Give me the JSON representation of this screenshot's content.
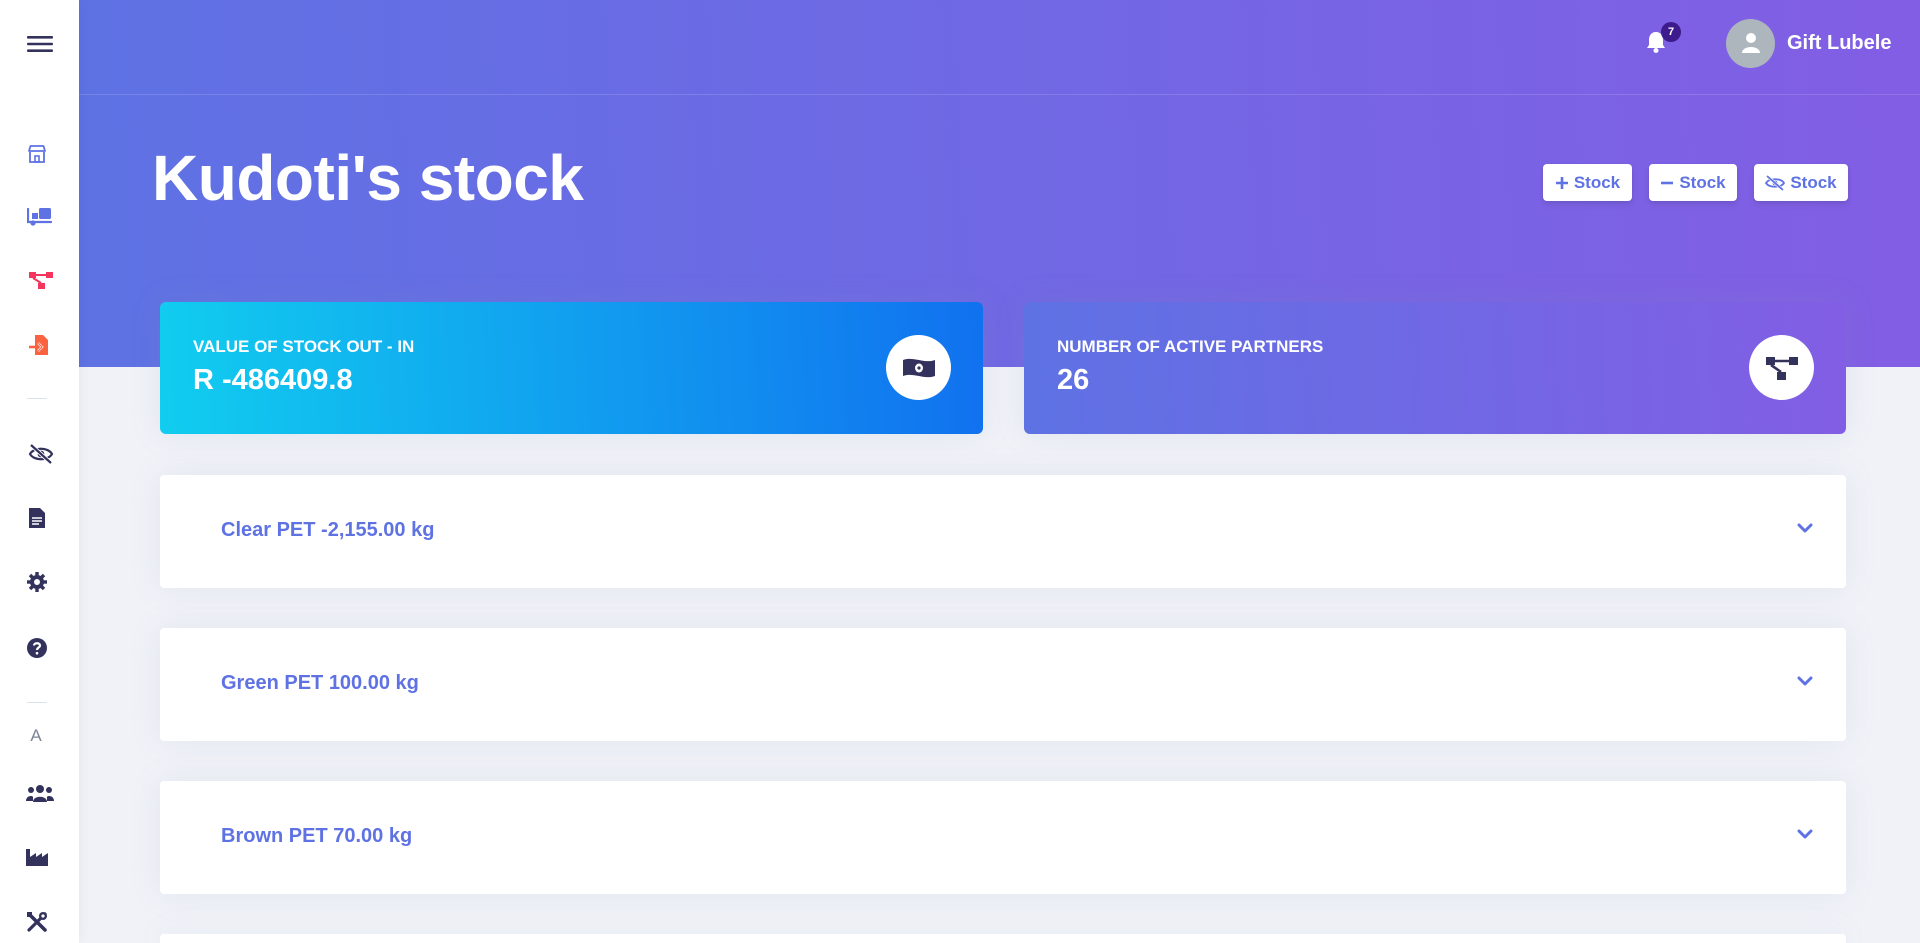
{
  "topbar": {
    "notification_count": "7",
    "user_name": "Gift Lubele"
  },
  "page": {
    "title": "Kudoti's stock"
  },
  "actions": [
    {
      "icon": "plus-icon",
      "label": "Stock"
    },
    {
      "icon": "minus-icon",
      "label": "Stock"
    },
    {
      "icon": "eye-slash-icon",
      "label": "Stock"
    }
  ],
  "stats": [
    {
      "label": "Value of stock out - in",
      "value": "R -486409.8",
      "icon": "money-bill-icon",
      "color_from": "#11cdef",
      "color_to": "#1171ef"
    },
    {
      "label": "Number of active partners",
      "value": "26",
      "icon": "network-icon",
      "color_from": "#5e72e4",
      "color_to": "#825ee4"
    }
  ],
  "stock_items": [
    {
      "label": "Clear PET -2,155.00 kg"
    },
    {
      "label": "Green PET 100.00 kg"
    },
    {
      "label": "Brown PET 70.00 kg"
    }
  ],
  "sidebar": {
    "letter": "A",
    "icons": [
      "menu-icon",
      "store-icon",
      "truck-loading-icon",
      "network-icon",
      "file-import-icon",
      "eye-slash-icon",
      "file-text-icon",
      "gear-icon",
      "help-circle-icon",
      "users-icon",
      "industry-icon",
      "tools-icon"
    ]
  },
  "colors": {
    "primary": "#5e72e4",
    "purple": "#825ee4",
    "info": "#11cdef",
    "badge": "#3d1b8c"
  }
}
